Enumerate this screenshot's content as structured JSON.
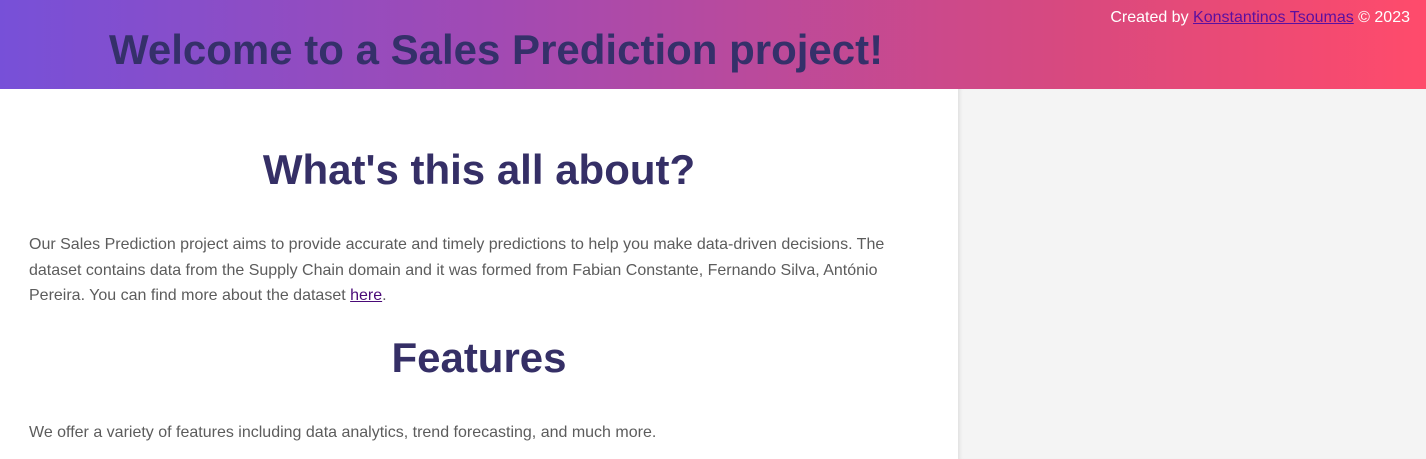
{
  "header": {
    "title": "Welcome to a Sales Prediction project!",
    "credit_prefix": "Created by ",
    "credit_author": "Konstantinos Tsoumas",
    "credit_suffix": " © 2023"
  },
  "main": {
    "about": {
      "heading": "What's this all about?",
      "text": "Our Sales Prediction project aims to provide accurate and timely predictions to help you make data-driven decisions. The dataset contains data from the Supply Chain domain and it was formed from Fabian Constante, Fernando Silva, António Pereira. You can find more about the dataset ",
      "link_text": "here",
      "text_end": "."
    },
    "features": {
      "heading": "Features",
      "text": "We offer a variety of features including data analytics, trend forecasting, and much more."
    }
  },
  "colors": {
    "gradient_start": "#7750d8",
    "gradient_end": "#ff4b6b",
    "heading": "#352f66",
    "body_text": "#5c5c5c",
    "link": "#4a0a78",
    "sidebar_bg": "#f4f4f4"
  }
}
